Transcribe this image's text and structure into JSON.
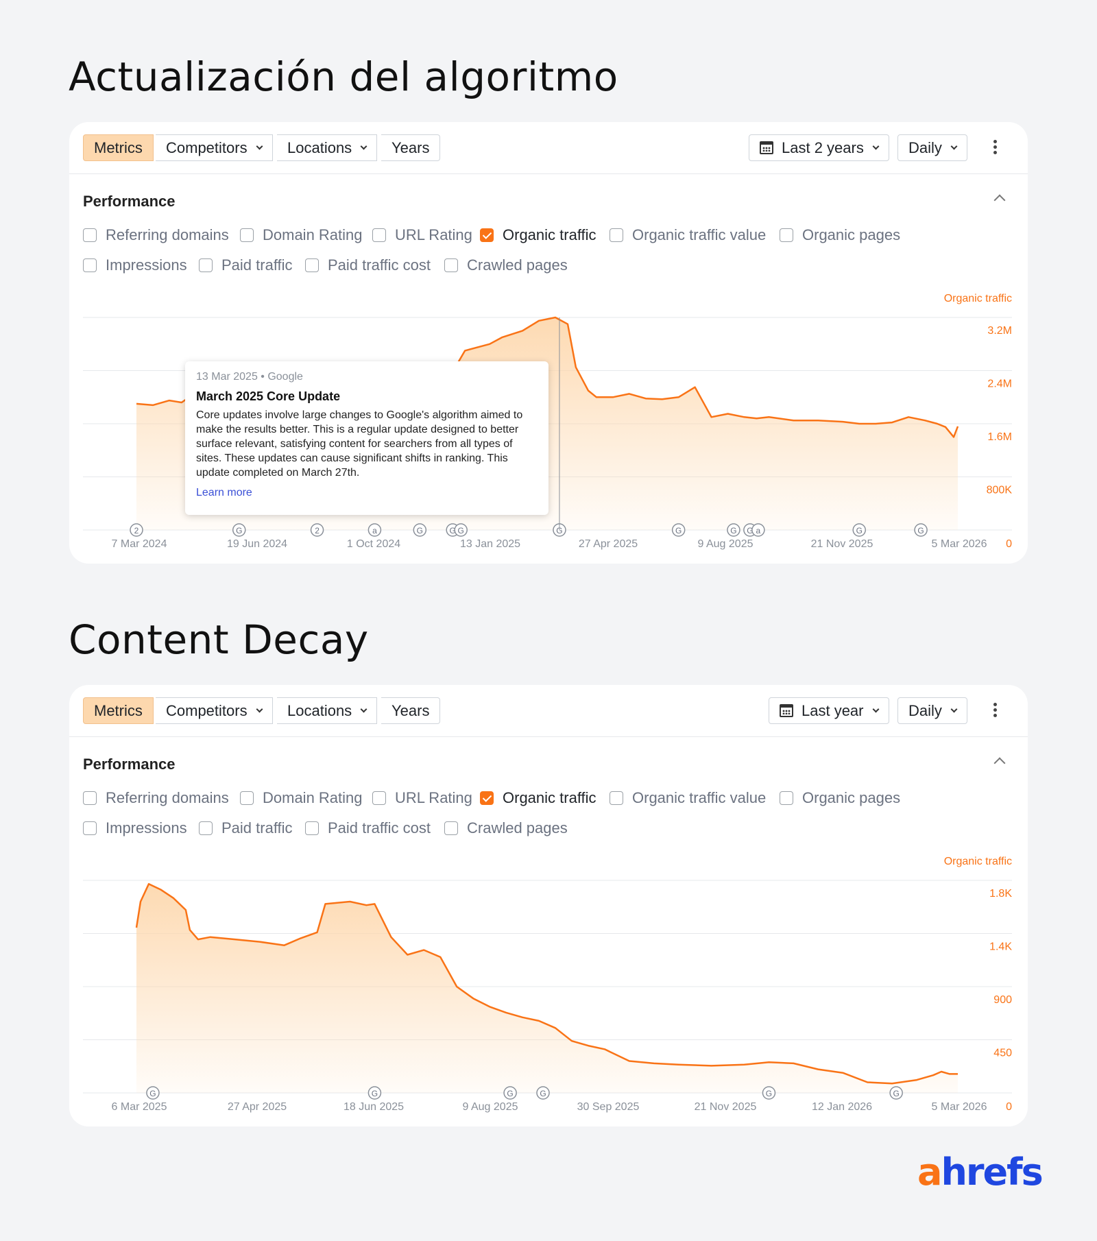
{
  "sections": [
    {
      "title": "Actualización del algoritmo",
      "toolbar": {
        "metrics": "Metrics",
        "competitors": "Competitors",
        "locations": "Locations",
        "years": "Years",
        "range": "Last 2 years",
        "interval": "Daily"
      },
      "performance_title": "Performance",
      "checkboxes": [
        {
          "label": "Referring domains",
          "checked": false
        },
        {
          "label": "Domain Rating",
          "checked": false
        },
        {
          "label": "URL Rating",
          "checked": false
        },
        {
          "label": "Organic traffic",
          "checked": true
        },
        {
          "label": "Organic traffic value",
          "checked": false
        },
        {
          "label": "Organic pages",
          "checked": false
        },
        {
          "label": "Impressions",
          "checked": false
        },
        {
          "label": "Paid traffic",
          "checked": false
        },
        {
          "label": "Paid traffic cost",
          "checked": false
        },
        {
          "label": "Crawled pages",
          "checked": false
        }
      ],
      "tooltip": {
        "meta": "13 Mar 2025 • Google",
        "title": "March 2025 Core Update",
        "body": "Core updates involve large changes to Google's algorithm aimed to make the results better. This is a regular update designed to better surface relevant, satisfying content for searchers from all types of sites. These updates can cause significant shifts in ranking. This update completed on March 27th.",
        "link": "Learn more"
      }
    },
    {
      "title": "Content Decay",
      "toolbar": {
        "metrics": "Metrics",
        "competitors": "Competitors",
        "locations": "Locations",
        "years": "Years",
        "range": "Last year",
        "interval": "Daily"
      },
      "performance_title": "Performance",
      "checkboxes": [
        {
          "label": "Referring domains",
          "checked": false
        },
        {
          "label": "Domain Rating",
          "checked": false
        },
        {
          "label": "URL Rating",
          "checked": false
        },
        {
          "label": "Organic traffic",
          "checked": true
        },
        {
          "label": "Organic traffic value",
          "checked": false
        },
        {
          "label": "Organic pages",
          "checked": false
        },
        {
          "label": "Impressions",
          "checked": false
        },
        {
          "label": "Paid traffic",
          "checked": false
        },
        {
          "label": "Paid traffic cost",
          "checked": false
        },
        {
          "label": "Crawled pages",
          "checked": false
        }
      ]
    }
  ],
  "colors": {
    "accent": "#f97316",
    "fill": "#fdd8ae",
    "logo_a": "#f97316",
    "logo_rest": "#1f47e0"
  },
  "logo": {
    "a": "a",
    "rest": "hrefs"
  },
  "chart_data": [
    {
      "type": "area",
      "series_name": "Organic traffic",
      "x_tick_labels": [
        "7 Mar 2024",
        "19 Jun 2024",
        "1 Oct 2024",
        "13 Jan 2025",
        "27 Apr 2025",
        "9 Aug 2025",
        "21 Nov 2025",
        "5 Mar 2026"
      ],
      "y_tick_labels": [
        "0",
        "800K",
        "1.6M",
        "2.4M",
        "3.2M"
      ],
      "ylim": [
        0,
        3200000
      ],
      "x": [
        0,
        0.02,
        0.04,
        0.055,
        0.07,
        0.09,
        0.105,
        0.12,
        0.15,
        0.19,
        0.23,
        0.27,
        0.31,
        0.36,
        0.4,
        0.43,
        0.445,
        0.47,
        0.49,
        0.51,
        0.525,
        0.535,
        0.55,
        0.56,
        0.58,
        0.6,
        0.62,
        0.64,
        0.66,
        0.68,
        0.7,
        0.72,
        0.74,
        0.755,
        0.77,
        0.8,
        0.83,
        0.86,
        0.88,
        0.9,
        0.92,
        0.94,
        0.96,
        0.975,
        0.985,
        0.995,
        1.0
      ],
      "values": [
        1900000,
        1880000,
        1950000,
        1920000,
        2050000,
        1750000,
        1700000,
        1650000,
        1600000,
        1580000,
        1620000,
        1650000,
        1700000,
        1850000,
        2700000,
        2800000,
        2900000,
        3000000,
        3150000,
        3200000,
        3100000,
        2450000,
        2100000,
        2000000,
        2000000,
        2050000,
        1980000,
        1970000,
        2000000,
        2150000,
        1700000,
        1750000,
        1700000,
        1680000,
        1700000,
        1650000,
        1650000,
        1630000,
        1600000,
        1600000,
        1620000,
        1700000,
        1650000,
        1600000,
        1550000,
        1400000,
        1560000
      ],
      "event_markers": [
        {
          "x": 0.0,
          "label": "2"
        },
        {
          "x": 0.125,
          "label": "G"
        },
        {
          "x": 0.22,
          "label": "2"
        },
        {
          "x": 0.29,
          "label": "a"
        },
        {
          "x": 0.345,
          "label": "G"
        },
        {
          "x": 0.385,
          "label": "G"
        },
        {
          "x": 0.395,
          "label": "G"
        },
        {
          "x": 0.515,
          "label": "G"
        },
        {
          "x": 0.66,
          "label": "G"
        },
        {
          "x": 0.727,
          "label": "G"
        },
        {
          "x": 0.747,
          "label": "G"
        },
        {
          "x": 0.757,
          "label": "a"
        },
        {
          "x": 0.88,
          "label": "G"
        },
        {
          "x": 0.955,
          "label": "G"
        }
      ]
    },
    {
      "type": "area",
      "series_name": "Organic traffic",
      "x_tick_labels": [
        "6 Mar 2025",
        "27 Apr 2025",
        "18 Jun 2025",
        "9 Aug 2025",
        "30 Sep 2025",
        "21 Nov 2025",
        "12 Jan 2026",
        "5 Mar 2026"
      ],
      "y_tick_labels": [
        "0",
        "450",
        "900",
        "1.4K",
        "1.8K"
      ],
      "ylim": [
        0,
        1800
      ],
      "x": [
        0,
        0.005,
        0.015,
        0.03,
        0.045,
        0.06,
        0.065,
        0.075,
        0.09,
        0.12,
        0.15,
        0.18,
        0.2,
        0.22,
        0.23,
        0.26,
        0.28,
        0.29,
        0.31,
        0.33,
        0.35,
        0.37,
        0.39,
        0.41,
        0.43,
        0.45,
        0.47,
        0.49,
        0.51,
        0.53,
        0.55,
        0.57,
        0.6,
        0.63,
        0.66,
        0.7,
        0.74,
        0.77,
        0.8,
        0.83,
        0.86,
        0.89,
        0.92,
        0.95,
        0.97,
        0.98,
        0.99,
        1.0
      ],
      "values": [
        1400,
        1620,
        1770,
        1720,
        1650,
        1550,
        1380,
        1300,
        1320,
        1300,
        1280,
        1250,
        1310,
        1360,
        1600,
        1620,
        1590,
        1600,
        1320,
        1170,
        1210,
        1150,
        900,
        800,
        730,
        680,
        640,
        610,
        550,
        440,
        400,
        370,
        270,
        250,
        240,
        230,
        240,
        260,
        250,
        200,
        170,
        90,
        80,
        110,
        150,
        180,
        160,
        160
      ],
      "event_markers": [
        {
          "x": 0.02,
          "label": "G"
        },
        {
          "x": 0.29,
          "label": "G"
        },
        {
          "x": 0.455,
          "label": "G"
        },
        {
          "x": 0.495,
          "label": "G"
        },
        {
          "x": 0.77,
          "label": "G"
        },
        {
          "x": 0.925,
          "label": "G"
        }
      ]
    }
  ]
}
